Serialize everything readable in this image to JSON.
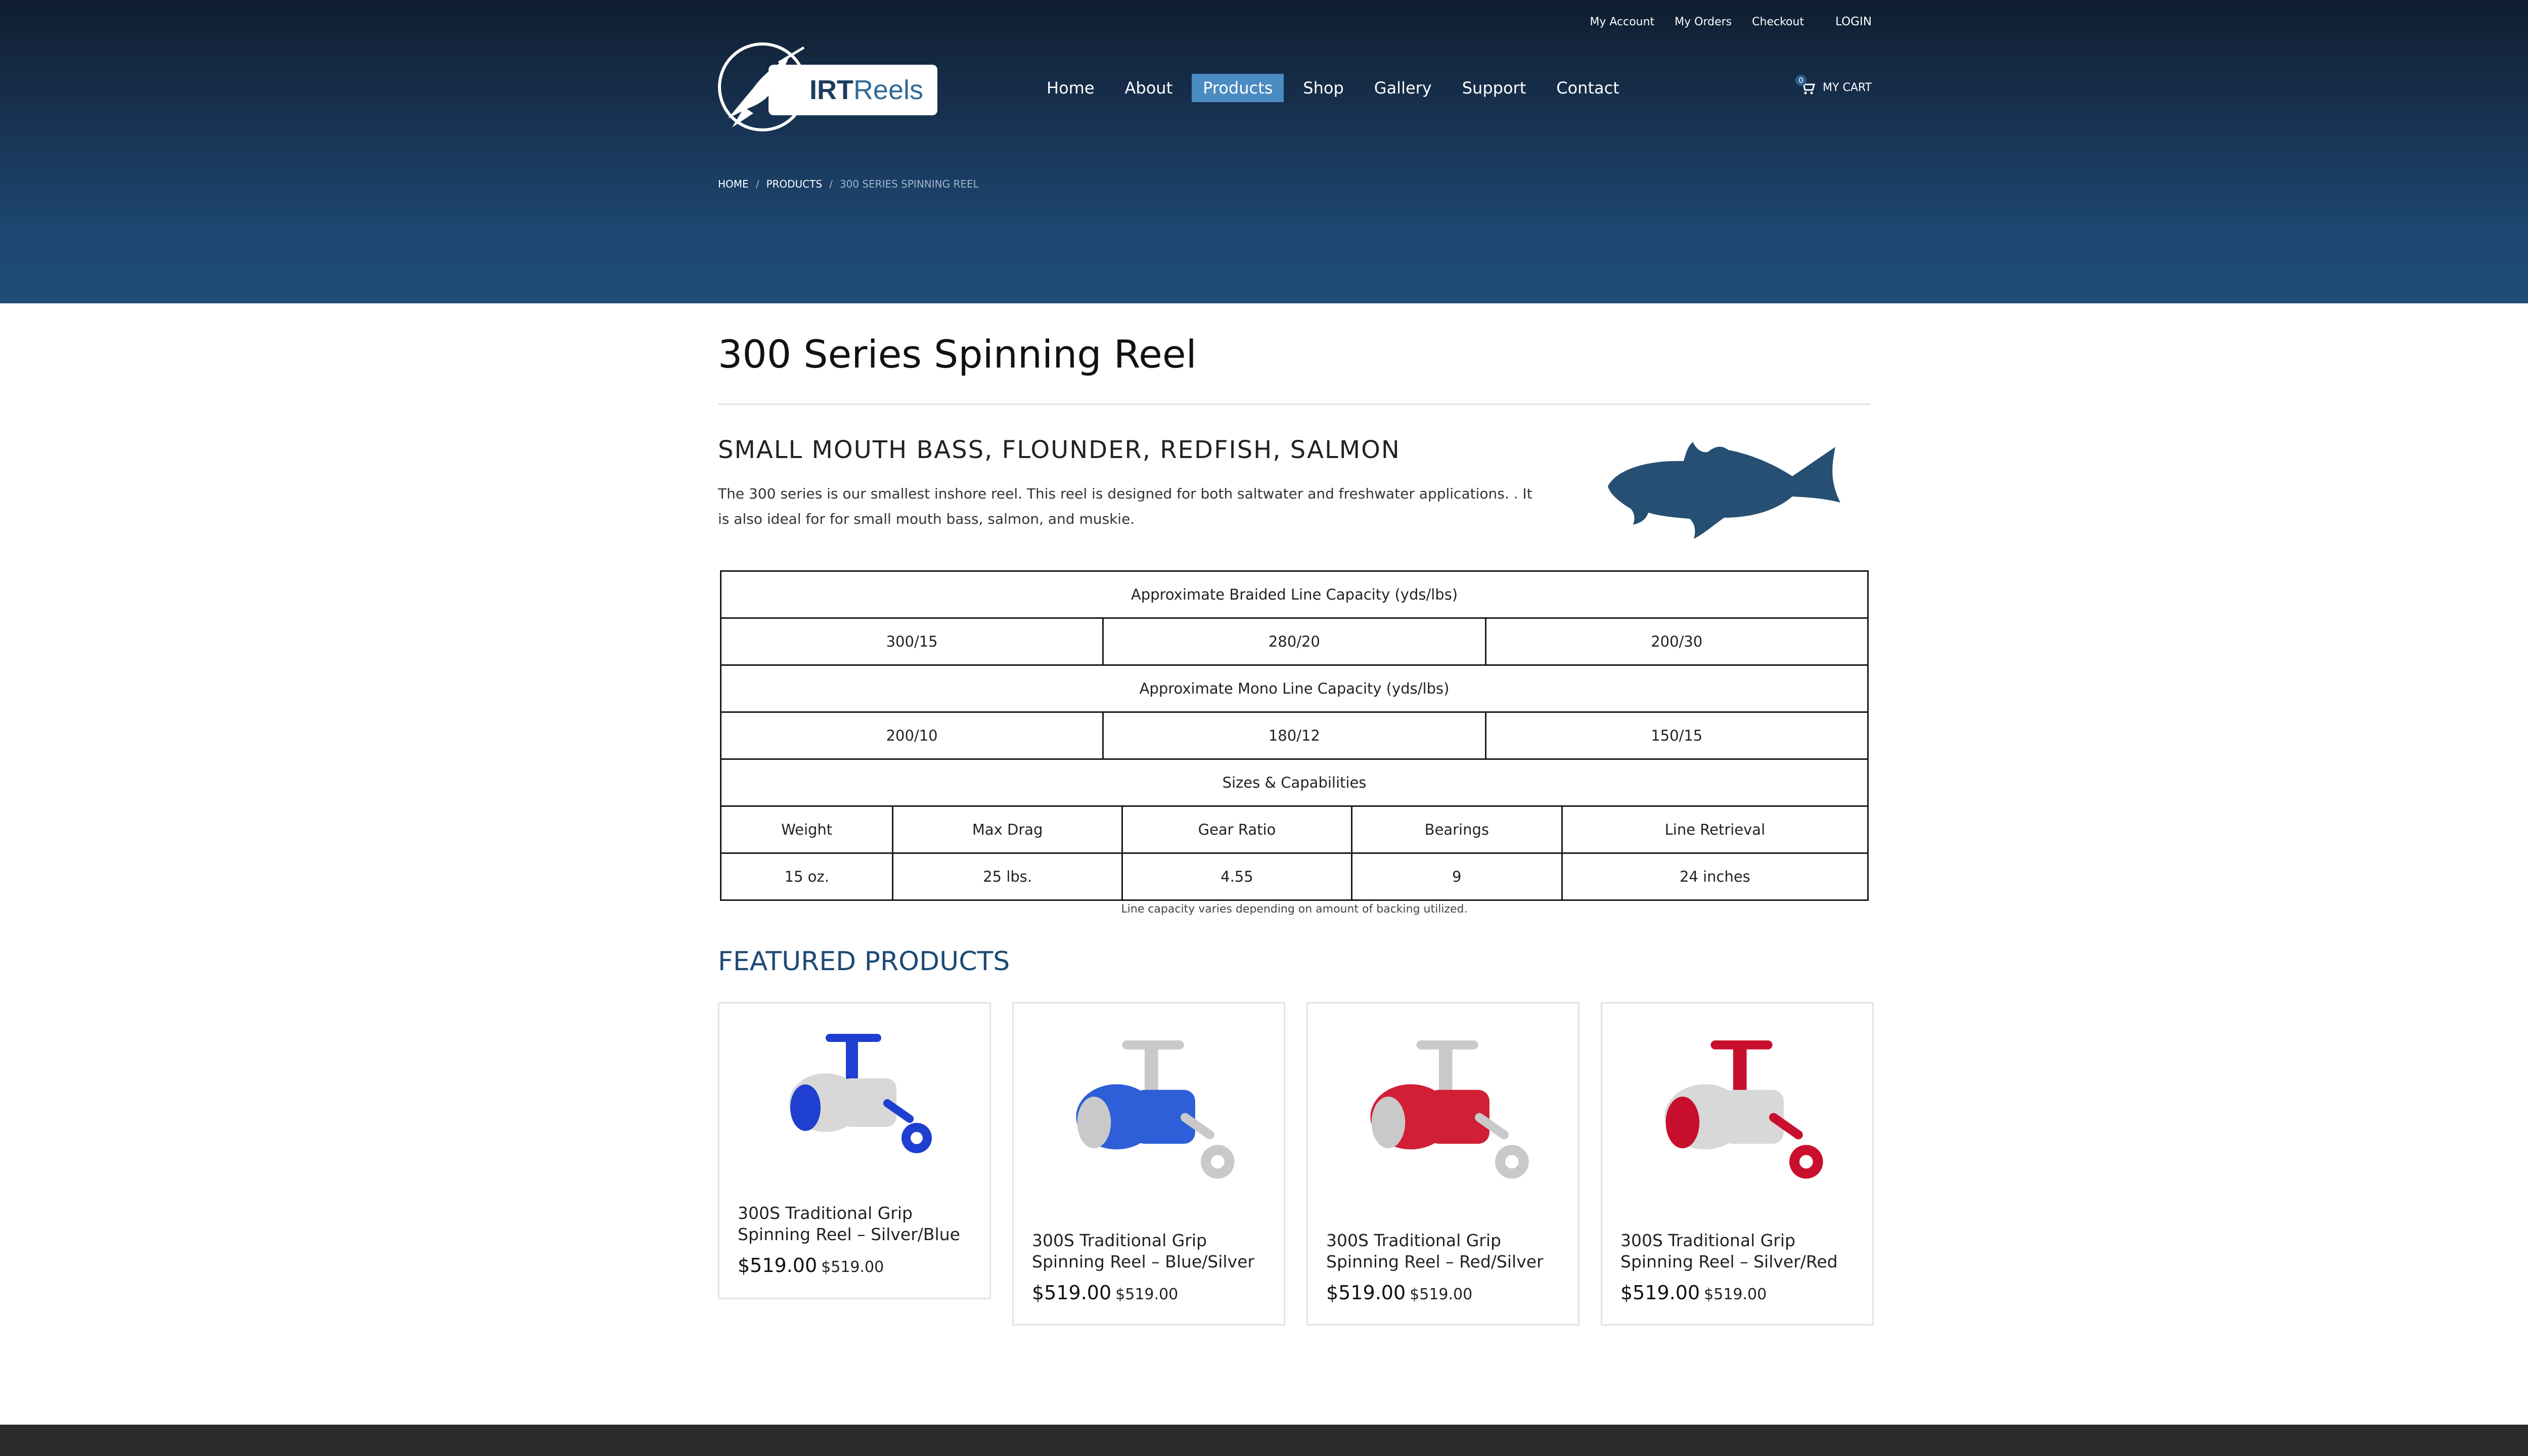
{
  "topbar": {
    "my_account": "My Account",
    "my_orders": "My Orders",
    "checkout": "Checkout",
    "login": "LOGIN"
  },
  "logo": {
    "text_bold": "IRT",
    "text_light": "Reels"
  },
  "nav": {
    "items": [
      {
        "label": "Home",
        "active": false
      },
      {
        "label": "About",
        "active": false
      },
      {
        "label": "Products",
        "active": true
      },
      {
        "label": "Shop",
        "active": false
      },
      {
        "label": "Gallery",
        "active": false
      },
      {
        "label": "Support",
        "active": false
      },
      {
        "label": "Contact",
        "active": false
      }
    ]
  },
  "cart": {
    "count": "0",
    "label": "MY CART"
  },
  "breadcrumb": {
    "home": "HOME",
    "products": "PRODUCTS",
    "current": "300 SERIES SPINNING REEL",
    "separator": "/"
  },
  "page": {
    "title": "300 Series Spinning Reel",
    "species": "SMALL MOUTH BASS, FLOUNDER, REDFISH, SALMON",
    "description": "The 300 series is our smallest inshore reel. This reel is designed for both saltwater and freshwater applications. . It is also ideal for for small mouth bass, salmon, and muskie."
  },
  "specs": {
    "braided_heading": "Approximate Braided Line Capacity (yds/lbs)",
    "braided_values": [
      "300/15",
      "280/20",
      "200/30"
    ],
    "mono_heading": "Approximate Mono Line Capacity (yds/lbs)",
    "mono_values": [
      "200/10",
      "180/12",
      "150/15"
    ],
    "sizes_heading": "Sizes & Capabilities",
    "columns": [
      "Weight",
      "Max Drag",
      "Gear Ratio",
      "Bearings",
      "Line Retrieval"
    ],
    "values": [
      "15 oz.",
      "25 lbs.",
      "4.55",
      "9",
      "24 inches"
    ],
    "footnote": "Line capacity varies depending on amount of backing utilized."
  },
  "featured": {
    "title": "FEATURED PRODUCTS",
    "products": [
      {
        "name": "300S Traditional Grip Spinning Reel – Silver/Blue",
        "price": "$519.00",
        "price2": "$519.00",
        "body_color": "#d8d8d8",
        "accent_color": "#1f3fd0"
      },
      {
        "name": "300S Traditional Grip Spinning Reel – Blue/Silver",
        "price": "$519.00",
        "price2": "$519.00",
        "body_color": "#2e5fd8",
        "accent_color": "#c9c9c9"
      },
      {
        "name": "300S Traditional Grip Spinning Reel – Red/Silver",
        "price": "$519.00",
        "price2": "$519.00",
        "body_color": "#d11f36",
        "accent_color": "#c9c9c9"
      },
      {
        "name": "300S Traditional Grip Spinning Reel – Silver/Red",
        "price": "$519.00",
        "price2": "$519.00",
        "body_color": "#d8d8d8",
        "accent_color": "#c8102e"
      }
    ]
  },
  "colors": {
    "header_dark": "#0f1e30",
    "header_light": "#1f4c78",
    "nav_active": "#4a8bc2",
    "featured_title": "#1d4a74",
    "fish": "#264f73",
    "footer": "#2b2b2b"
  },
  "icons": {
    "logo": "marlin-logo",
    "cart": "shopping-cart-icon",
    "species": "redfish-silhouette"
  }
}
